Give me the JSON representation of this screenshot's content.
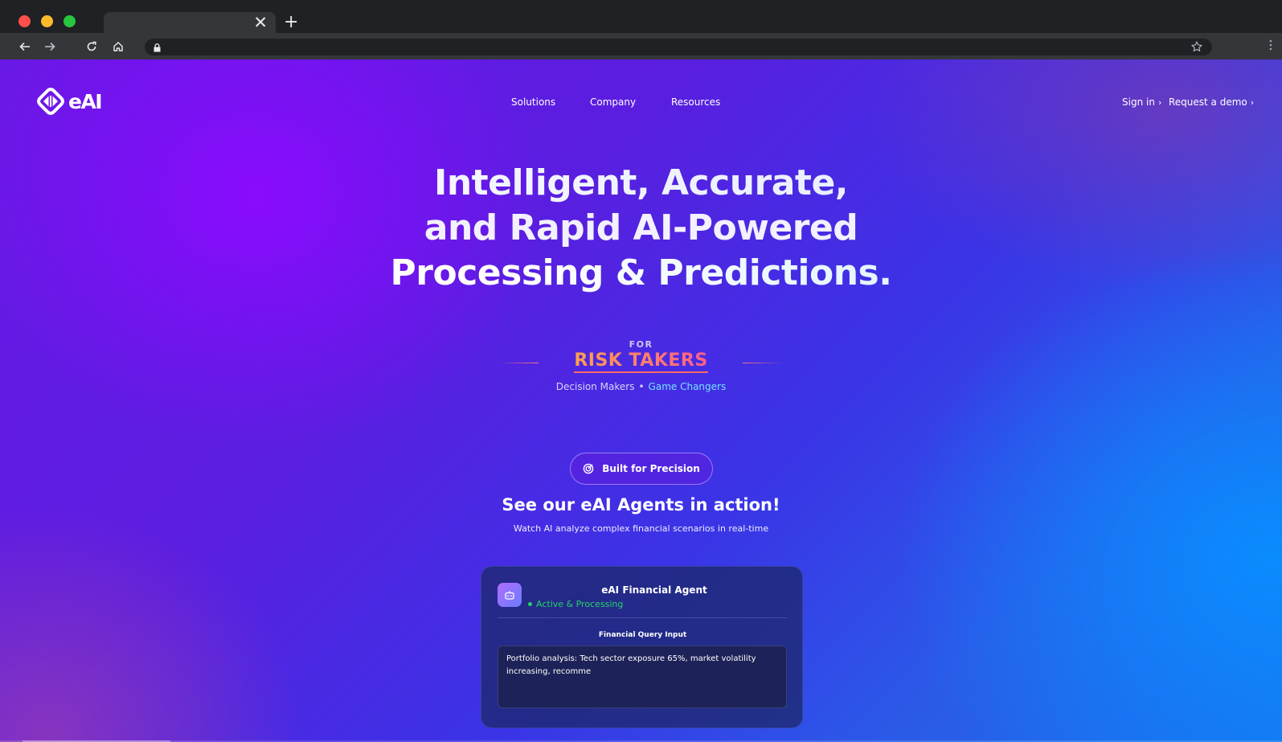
{
  "browser": {
    "tab_close_glyph": "✕",
    "new_tab_glyph": "+",
    "icons": [
      "back-arrow-icon",
      "forward-arrow-icon",
      "reload-icon",
      "home-icon",
      "lock-icon",
      "star-icon",
      "kebab-menu-icon"
    ]
  },
  "header": {
    "logo_text": "eAI",
    "nav": [
      {
        "label": "Solutions"
      },
      {
        "label": "Company"
      },
      {
        "label": "Resources"
      }
    ],
    "sign_in": "Sign in",
    "request_demo": "Request a demo",
    "chevron": "›"
  },
  "hero": {
    "line1": "Intelligent, Accurate,",
    "line2": "and Rapid AI-Powered",
    "line3": "Processing & Predictions.",
    "for_label": "FOR",
    "audience": "RISK TAKERS",
    "roles_a": "Decision Makers",
    "roles_sep": "•",
    "roles_b": "Game Changers"
  },
  "cta": {
    "pill_label": "Built for Precision",
    "section_title": "See our eAI Agents in action!",
    "section_subtitle": "Watch AI analyze complex financial scenarios in real-time"
  },
  "agent": {
    "name": "eAI Financial Agent",
    "status": "Active & Processing",
    "query_label": "Financial Query Input",
    "query_text": "Portfolio analysis: Tech sector exposure 65%, market volatility increasing, recomme"
  },
  "colors": {
    "accent_purple": "#8a1cff",
    "accent_blue": "#0a8cff",
    "status_green": "#23d36a",
    "risk_gradient_start": "#ffa24a",
    "risk_gradient_end": "#ff5e8a",
    "game_changers": "#74e3ff"
  }
}
